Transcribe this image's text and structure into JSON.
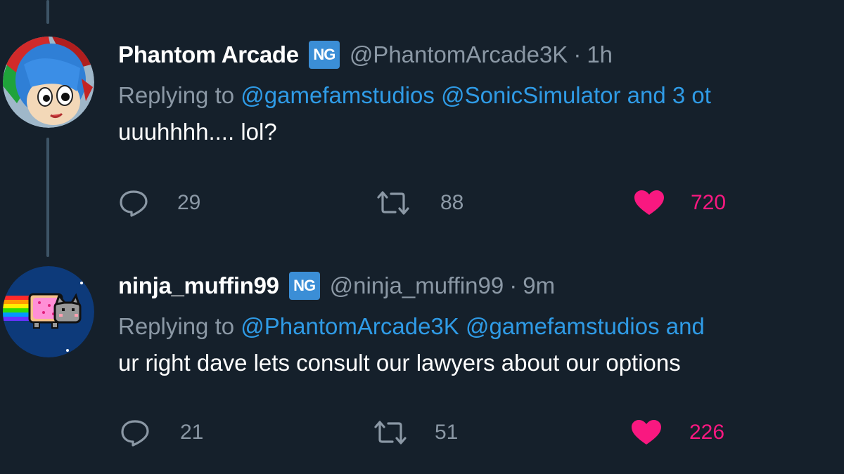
{
  "colors": {
    "background": "#15202b",
    "text_primary": "#ffffff",
    "text_secondary": "#8b98a5",
    "mention_blue": "#2f9be6",
    "like_pink": "#f91880",
    "badge_blue": "#3b8ed6"
  },
  "tweets": [
    {
      "display_name": "Phantom Arcade",
      "badge": "NG",
      "handle": "@PhantomArcade3K",
      "dot": "·",
      "time": "1h",
      "replying_prefix": "Replying to",
      "replying_mentions": "@gamefamstudios @SonicSimulator and 3 ot",
      "text": "uuuhhhh.... lol?",
      "reply_count": "29",
      "retweet_count": "88",
      "like_count": "720",
      "avatar_icon": "cartoon-character-avatar"
    },
    {
      "display_name": "ninja_muffin99",
      "badge": "NG",
      "handle": "@ninja_muffin99",
      "dot": "·",
      "time": "9m",
      "replying_prefix": "Replying to",
      "replying_mentions": "@PhantomArcade3K @gamefamstudios and",
      "text": "ur right dave lets consult our lawyers about our options",
      "reply_count": "21",
      "retweet_count": "51",
      "like_count": "226",
      "avatar_icon": "nyan-cat-avatar"
    }
  ],
  "icons": {
    "reply": "reply-bubble-icon",
    "retweet": "retweet-arrows-icon",
    "like": "heart-filled-icon"
  }
}
